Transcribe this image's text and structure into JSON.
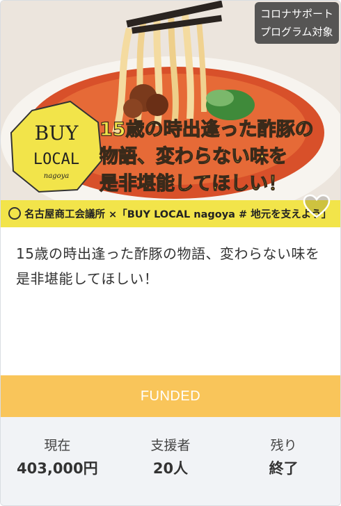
{
  "badge": {
    "line1": "コロナサポート",
    "line2": "プログラム対象"
  },
  "hero": {
    "logo_top": "BUY",
    "logo_mid": "LOCAL",
    "logo_sub": "nagoya",
    "headline_line1": "15歳の時出逢った酢豚の",
    "headline_line2": "物語、変わらない味を",
    "headline_line3": "是非堪能してほしい！",
    "banner_text": "名古屋商工会議所 ×「BUY LOCAL nagoya # 地元を支えよう」"
  },
  "card": {
    "title": "15歳の時出逢った酢豚の物語、変わらない味を是非堪能してほしい！",
    "status": "FUNDED"
  },
  "stats": [
    {
      "label": "現在",
      "value": "403,000円"
    },
    {
      "label": "支援者",
      "value": "20人"
    },
    {
      "label": "残り",
      "value": "終了"
    }
  ],
  "colors": {
    "funded_bg": "#f9c55a",
    "stats_bg": "#f1f3f6",
    "banner_yellow": "#f2e44a"
  }
}
